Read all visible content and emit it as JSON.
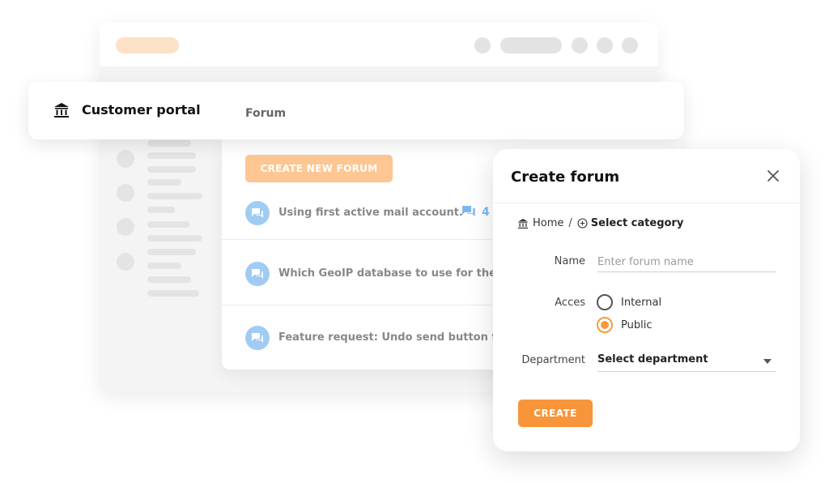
{
  "portal": {
    "title": "Customer portal",
    "section": "Forum"
  },
  "forum": {
    "create_button": "CREATE NEW FORUM",
    "topics": [
      {
        "title": "Using first active mail account.",
        "replies": "4"
      },
      {
        "title": "Which GeoIP database to use for the Liv",
        "replies": ""
      },
      {
        "title": "Feature request: Undo send button for e",
        "replies": ""
      }
    ]
  },
  "modal": {
    "title": "Create forum",
    "breadcrumb": {
      "home": "Home",
      "separator": "/",
      "category": "Select category"
    },
    "name_label": "Name",
    "name_placeholder": "Enter forum name",
    "access_label": "Acces",
    "access_options": [
      {
        "label": "Internal",
        "checked": false
      },
      {
        "label": "Public",
        "checked": true
      }
    ],
    "department_label": "Department",
    "department_value": "Select department",
    "create_button": "CREATE"
  },
  "colors": {
    "accent": "#f8953a",
    "accent_light": "#fdc692",
    "topic_icon": "#9fccf2",
    "reply_blue": "#7db7ee"
  },
  "icons": {
    "portal": "bank-icon",
    "topic": "chat-bubble-icon",
    "replies": "comments-icon",
    "close": "close-icon",
    "home": "bank-icon",
    "category": "circle-plus-icon",
    "dropdown": "caret-down-icon"
  }
}
